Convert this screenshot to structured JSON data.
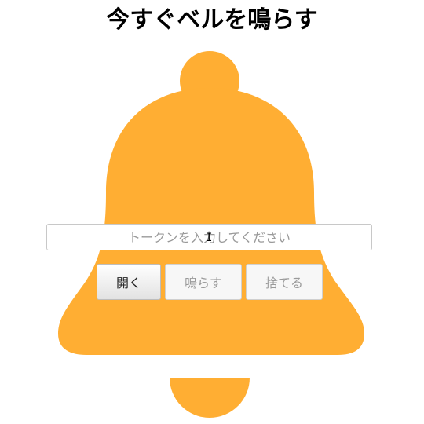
{
  "header": {
    "title": "今すぐベルを鳴らす"
  },
  "bell": {
    "color": "#FFAE33",
    "icon": "bell-icon"
  },
  "form": {
    "token_placeholder": "トークンを入力してください",
    "token_value": ""
  },
  "buttons": {
    "open_label": "開く",
    "ring_label": "鳴らす",
    "discard_label": "捨てる"
  },
  "cursor": {
    "icon": "text-cursor-icon"
  }
}
